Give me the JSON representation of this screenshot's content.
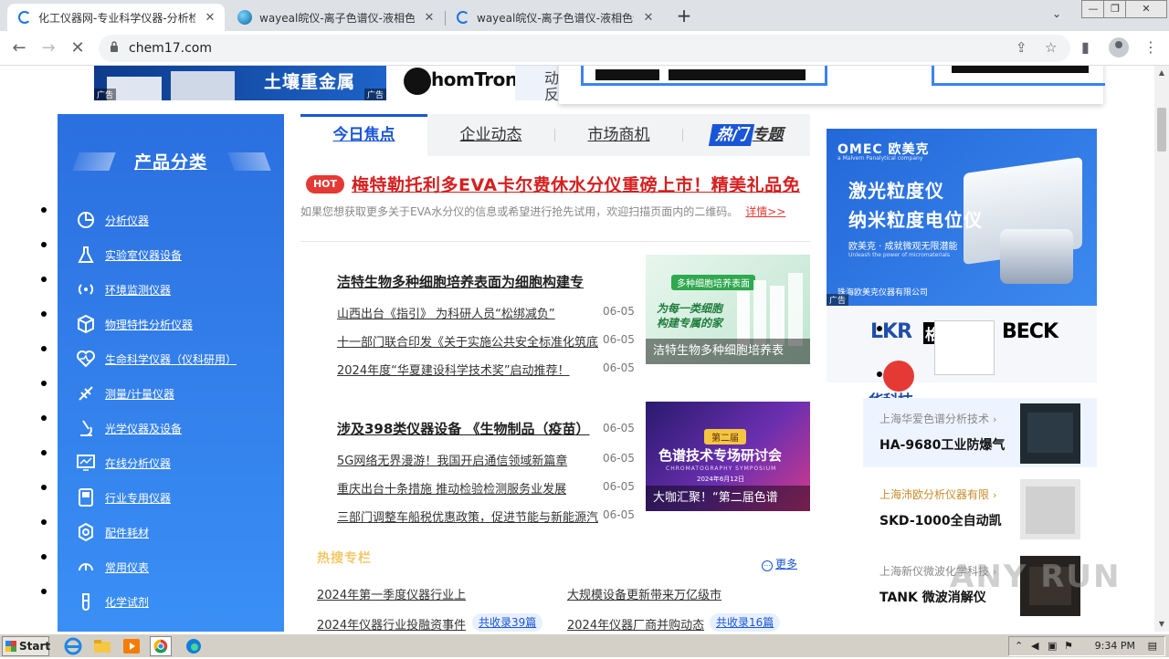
{
  "browser": {
    "tabs": [
      {
        "title": "化工仪器网-专业科学仪器-分析检测",
        "active": true
      },
      {
        "title": "wayeal皖仪-离子色谱仪-液相色谱仪"
      },
      {
        "title": "wayeal皖仪-离子色谱仪-液相色谱仪"
      }
    ],
    "url": "chem17.com",
    "new_tab": "+",
    "tab_close": "✕",
    "tab_list": "⌄",
    "window_controls": {
      "minimize": "—",
      "maximize": "❐",
      "close": "✕"
    }
  },
  "banners": {
    "ad_label": "广告",
    "soil_text": "土壤重金属",
    "logo_text": "homTron",
    "side_chars": [
      "动",
      "反"
    ]
  },
  "category_nav": {
    "title": "产品分类",
    "items": [
      {
        "label": "分析仪器",
        "icon": "pie-chart-icon"
      },
      {
        "label": "实验室仪器设备",
        "icon": "flask-icon"
      },
      {
        "label": "环境监测仪器",
        "icon": "signal-icon"
      },
      {
        "label": "物理特性分析仪器",
        "icon": "cube-icon"
      },
      {
        "label": "生命科学仪器（仪科研用）",
        "icon": "heart-pulse-icon"
      },
      {
        "label": "测量/计量仪器",
        "icon": "ruler-icon"
      },
      {
        "label": "光学仪器及设备",
        "icon": "microscope-icon"
      },
      {
        "label": "在线分析仪器",
        "icon": "monitor-chart-icon"
      },
      {
        "label": "行业专用仪器",
        "icon": "device-icon"
      },
      {
        "label": "配件耗材",
        "icon": "gear-icon"
      },
      {
        "label": "常用仪表",
        "icon": "gauge-icon"
      },
      {
        "label": "化学试剂",
        "icon": "test-tube-icon"
      }
    ]
  },
  "center_tabs": {
    "t1": "今日焦点",
    "t2": "企业动态",
    "t3": "市场商机",
    "t4_badge": "热门",
    "t4": "专题"
  },
  "headline": {
    "hot": "HOT",
    "title": "梅特勒托利多EVA卡尔费休水分仪重磅上市！精美礼品免",
    "sub": "如果您想获取更多关于EVA水分仪的信息或希望进行抢先试用，欢迎扫描页面内的二维码。",
    "more": "详情>>"
  },
  "news_blocks": [
    {
      "main": "洁特生物多种细胞培养表面为细胞构建专",
      "main_date": "",
      "items": [
        {
          "title": "山西出台《指引》 为科研人员“松绑减负”",
          "date": "06-05"
        },
        {
          "title": "十一部门联合印发《关于实施公共安全标准化筑底",
          "date": "06-05"
        },
        {
          "title": "2024年度“华夏建设科学技术奖”启动推荐！",
          "date": "06-05"
        }
      ],
      "thumb_caption": "洁特生物多种细胞培养表",
      "thumb_badge": "多种细胞培养表面",
      "thumb_lines": [
        "为每一类细胞",
        "构建专属的家"
      ]
    },
    {
      "main": "涉及398类仪器设备 《生物制品（疫苗）",
      "main_date": "06-05",
      "items": [
        {
          "title": "5G网络无界漫游！我国开启通信领域新篇章",
          "date": "06-05"
        },
        {
          "title": "重庆出台十条措施 推动检验检测服务业发展",
          "date": "06-05"
        },
        {
          "title": "三部门调整车船税优惠政策，促进节能与新能源汽",
          "date": "06-05"
        }
      ],
      "thumb_caption": "大咖汇聚！“第二届色谱",
      "thumb_badge": "第二届",
      "thumb_lines": [
        "色谱技术专场研讨会",
        "CHROMATOGRAPHY SYMPOSIUM",
        "2024年6月12日"
      ]
    }
  ],
  "hot_columns": {
    "title": "热搜专栏",
    "more": "更多",
    "links": [
      {
        "title": "2024年第一季度仪器行业上",
        "pill": ""
      },
      {
        "title": "大规模设备更新带来万亿级市",
        "pill": ""
      },
      {
        "title": "2024年仪器行业投融资事件",
        "pill": "共收录39篇"
      },
      {
        "title": "2024年仪器厂商并购动态",
        "pill": "共收录16篇"
      }
    ]
  },
  "right_ad": {
    "brand": "OMEC 欧美克",
    "brand_sub": "a Malvern Panalytical company",
    "line1": "激光粒度仪",
    "line2": "纳米粒度电位仪",
    "line3": "欧美克 · 成就微观无限潜能",
    "line4": "Unleash the power of micromaterials",
    "line5": "珠海欧美克仪器有限公司",
    "ad_label": "广告"
  },
  "partner_logos": [
    "LKR",
    "格林",
    "BECK",
    "华科技"
  ],
  "products": [
    {
      "company": "上海华爱色谱分析技术",
      "name": "HA-9680工业防爆气",
      "arrow": "›",
      "highlight": true
    },
    {
      "company": "上海沛欧分析仪器有限",
      "name": "SKD-1000全自动凯",
      "arrow": "›",
      "highlight": false
    },
    {
      "company": "上海新仪微波化学科技",
      "name": "TANK 微波消解仪",
      "arrow": "›",
      "highlight": false
    }
  ],
  "watermark": "ANY RUN",
  "taskbar": {
    "start": "Start",
    "clock": "9:34 PM"
  },
  "colors": {
    "accent": "#1a55d6",
    "nav_blue": "#2b6fe0",
    "headline_red": "#d61f1f",
    "hot_title": "#f3c86a"
  }
}
